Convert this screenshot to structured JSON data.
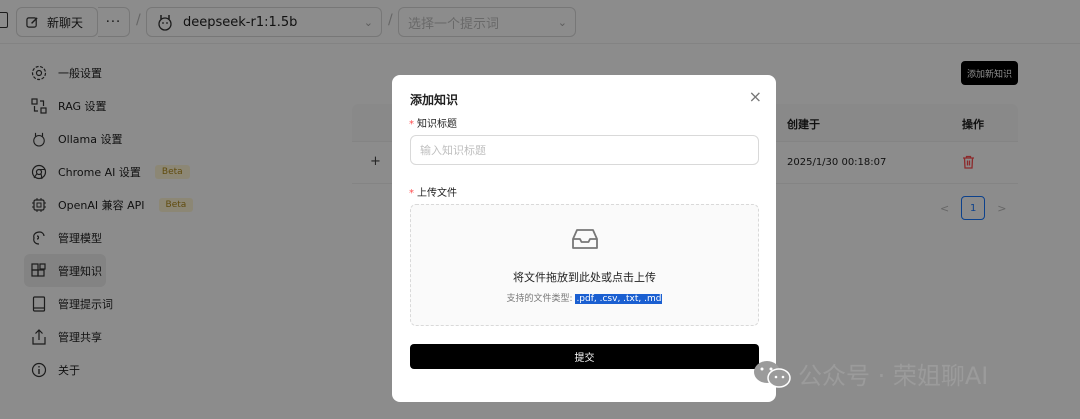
{
  "header": {
    "new_chat_label": "新聊天",
    "more_label": "···",
    "model_name": "deepseek-r1:1.5b",
    "prompt_placeholder": "选择一个提示词"
  },
  "sidebar": {
    "items": [
      {
        "label": "一般设置",
        "icon": "settings-icon"
      },
      {
        "label": "RAG 设置",
        "icon": "rag-icon"
      },
      {
        "label": "Ollama 设置",
        "icon": "ollama-icon"
      },
      {
        "label": "Chrome AI 设置",
        "icon": "chrome-icon",
        "badge": "Beta"
      },
      {
        "label": "OpenAI 兼容 API",
        "icon": "chip-icon",
        "badge": "Beta"
      },
      {
        "label": "管理模型",
        "icon": "brain-icon"
      },
      {
        "label": "管理知识",
        "icon": "blocks-icon",
        "active": true
      },
      {
        "label": "管理提示词",
        "icon": "book-icon"
      },
      {
        "label": "管理共享",
        "icon": "share-icon"
      },
      {
        "label": "关于",
        "icon": "info-icon"
      }
    ]
  },
  "main": {
    "add_button": "添加新知识",
    "columns": {
      "created": "创建于",
      "actions": "操作"
    },
    "row": {
      "expand": "+",
      "created": "2025/1/30 00:18:07"
    },
    "pagination": {
      "prev": "<",
      "page": "1",
      "next": ">"
    }
  },
  "modal": {
    "title": "添加知识",
    "close": "×",
    "title_label": "知识标题",
    "title_placeholder": "输入知识标题",
    "file_label": "上传文件",
    "required_mark": "*",
    "drop_text": "将文件拖放到此处或点击上传",
    "supported_prefix": "支持的文件类型:",
    "supported_types": ".pdf, .csv, .txt, .md",
    "submit_label": "提交"
  },
  "watermark": "公众号 · 荣姐聊AI",
  "colors": {
    "accent": "#1677ff",
    "danger": "#ff4d4f",
    "primary_button": "#000000",
    "selection": "#1a5fd1"
  }
}
